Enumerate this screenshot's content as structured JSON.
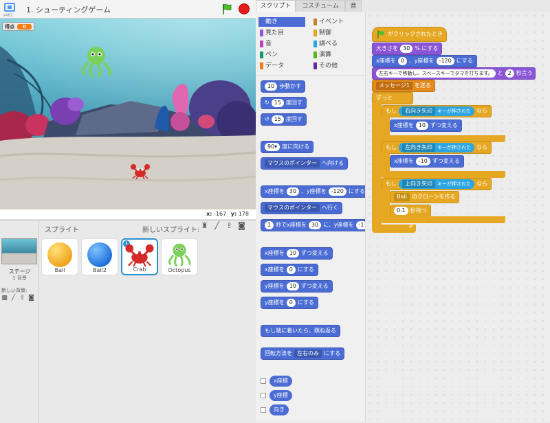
{
  "project": {
    "title": "1. シューティングゲーム",
    "version": "v461"
  },
  "stage": {
    "score_label": "得点",
    "score_value": "0",
    "coords": {
      "x_label": "x:",
      "x": "-167",
      "y_label": "y:",
      "y": "178"
    }
  },
  "sprites": {
    "title": "スプライト",
    "new_sprite_label": "新しいスプライト:",
    "stage_label": "ステージ",
    "stage_backdrop_count": "1 背景",
    "new_backdrop_label": "新しい背景:",
    "items": [
      {
        "name": "Ball",
        "color": "#f7b731"
      },
      {
        "name": "Ball2",
        "color": "#2e8fe6"
      },
      {
        "name": "Crab",
        "color": "#d42a2a"
      },
      {
        "name": "Octopus",
        "color": "#7cd05c"
      }
    ],
    "selected": "Crab"
  },
  "tabs": [
    "スクリプト",
    "コスチューム",
    "音"
  ],
  "categories": [
    {
      "label": "動き",
      "color": "#4a6cd4"
    },
    {
      "label": "イベント",
      "color": "#c88330"
    },
    {
      "label": "見た目",
      "color": "#8a55d7"
    },
    {
      "label": "制御",
      "color": "#e1a91a"
    },
    {
      "label": "音",
      "color": "#bb42c3"
    },
    {
      "label": "調べる",
      "color": "#2ca5e2"
    },
    {
      "label": "ペン",
      "color": "#0e9a6c"
    },
    {
      "label": "演算",
      "color": "#5cb712"
    },
    {
      "label": "データ",
      "color": "#ee7d16"
    },
    {
      "label": "その他",
      "color": "#632d99"
    }
  ],
  "palette": {
    "move": {
      "n": "10",
      "t": "歩動かす"
    },
    "turn_right": {
      "n": "15",
      "t": "度回す"
    },
    "turn_left": {
      "n": "15",
      "t": "度回す"
    },
    "point_dir": {
      "n": "90▾",
      "t": "度に向ける"
    },
    "point_towards": {
      "d": "マウスのポインター",
      "t": "へ向ける"
    },
    "goto_xy": {
      "a": "x座標を",
      "x": "30",
      "b": "、y座標を",
      "y": "-120",
      "c": "にする"
    },
    "goto": {
      "d": "マウスのポインター",
      "t": "へ行く"
    },
    "glide": {
      "a": "1",
      "b": "秒でx座標を",
      "x": "30",
      "c": "に、y座標を",
      "y": "-1"
    },
    "change_x": {
      "a": "x座標を",
      "n": "10",
      "t": "ずつ変える"
    },
    "set_x": {
      "a": "x座標を",
      "n": "0",
      "t": "にする"
    },
    "change_y": {
      "a": "y座標を",
      "n": "10",
      "t": "ずつ変える"
    },
    "set_y": {
      "a": "y座標を",
      "n": "0",
      "t": "にする"
    },
    "bounce": "もし端に着いたら、跳ね返る",
    "rotation": {
      "a": "回転方法を",
      "d": "左右のみ",
      "t": "にする"
    },
    "rep_x": "x座標",
    "rep_y": "y座標",
    "rep_dir": "向き"
  },
  "script": {
    "hat": "がクリックされたとき",
    "size": {
      "a": "大きさを",
      "n": "30",
      "t": "% にする"
    },
    "goto": {
      "a": "x座標を",
      "x": "0",
      "b": "、y座標を",
      "y": "-120",
      "c": "にする"
    },
    "say": {
      "msg": "左右キーで移動し、スペースキーでタマを打ちます。",
      "a": "と",
      "n": "2",
      "t": "秒言う"
    },
    "broadcast": {
      "d": "メッセージ1",
      "t": "を送る"
    },
    "forever": "ずっと",
    "if1": {
      "a": "もし",
      "key": "右向き矢印",
      "b": "キーが押された",
      "c": "なら"
    },
    "chg1": {
      "a": "x座標を",
      "n": "10",
      "t": "ずつ変える"
    },
    "if2": {
      "a": "もし",
      "key": "左向き矢印",
      "b": "キーが押された",
      "c": "なら"
    },
    "chg2": {
      "a": "x座標を",
      "n": "-10",
      "t": "ずつ変える"
    },
    "if3": {
      "a": "もし",
      "key": "上向き矢印",
      "b": "キーが押された",
      "c": "なら"
    },
    "clone": {
      "d": "Ball",
      "t": "のクローンを作る"
    },
    "wait": {
      "n": "0.1",
      "t": "秒待つ"
    }
  }
}
